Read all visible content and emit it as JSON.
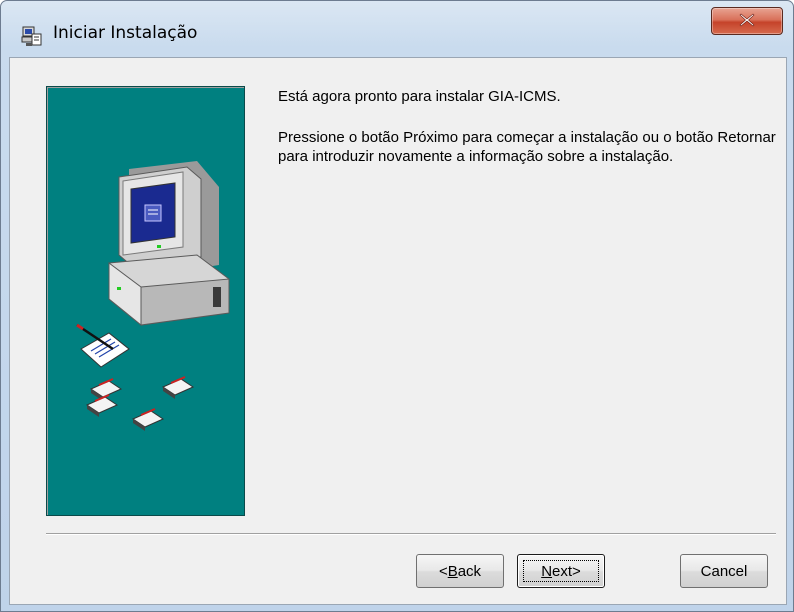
{
  "window": {
    "title": "Iniciar Instalação",
    "close_label": "x"
  },
  "content": {
    "heading": "Está agora pronto para instalar GIA-ICMS.",
    "body": "Pressione o botão Próximo para começar a instalação ou o botão Retornar para introduzir novamente a informação sobre a instalação."
  },
  "buttons": {
    "back": {
      "prefix": "< ",
      "mnemonic": "B",
      "rest": "ack"
    },
    "next": {
      "mnemonic": "N",
      "rest": "ext",
      "suffix": " >"
    },
    "cancel": {
      "label": "Cancel"
    }
  },
  "colors": {
    "side_panel": "#008080",
    "dialog_bg": "#f0f0f0",
    "close_button": "#c5432a"
  },
  "icons": {
    "app": "installer-icon",
    "close": "close-icon",
    "side": "computer-with-disks-illustration"
  }
}
